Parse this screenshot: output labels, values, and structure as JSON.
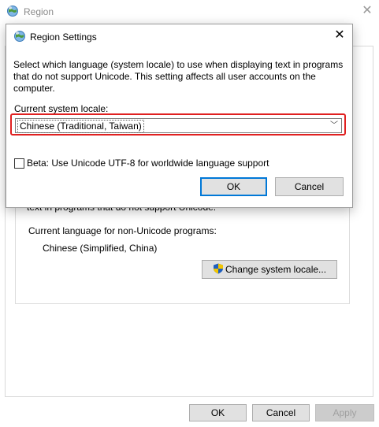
{
  "background_window": {
    "title": "Region",
    "icon": "globe-icon",
    "partial_text": "text in programs that do not support Unicode.",
    "current_language_label": "Current language for non-Unicode programs:",
    "current_language_value": "Chinese (Simplified, China)",
    "change_locale_button": "Change system locale...",
    "buttons": {
      "ok": "OK",
      "cancel": "Cancel",
      "apply": "Apply"
    }
  },
  "dialog": {
    "title": "Region Settings",
    "icon": "globe-icon",
    "description": "Select which language (system locale) to use when displaying text in programs that do not support Unicode. This setting affects all user accounts on the computer.",
    "locale_label": "Current system locale:",
    "locale_selected": "Chinese (Traditional, Taiwan)",
    "beta_checkbox_label": "Beta: Use Unicode UTF-8 for worldwide language support",
    "beta_checked": false,
    "ok": "OK",
    "cancel": "Cancel"
  },
  "colors": {
    "highlight": "#e02020",
    "default_button_border": "#0078d7",
    "button_face": "#e1e1e1"
  }
}
